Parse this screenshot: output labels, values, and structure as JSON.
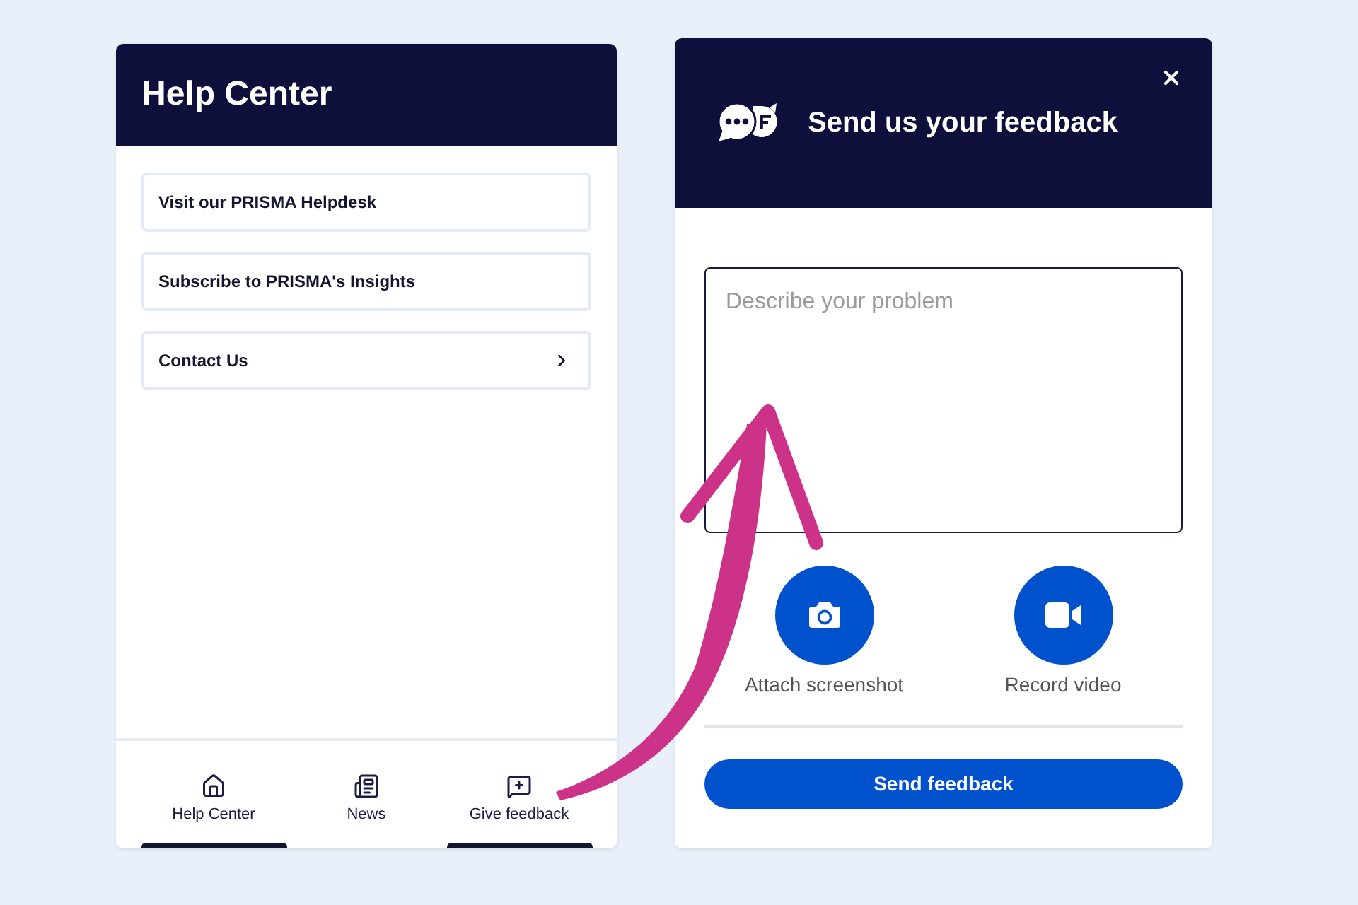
{
  "help_center": {
    "title": "Help Center",
    "links": [
      {
        "label": "Visit our PRISMA Helpdesk",
        "kind": "link"
      },
      {
        "label": "Subscribe to PRISMA's Insights",
        "kind": "link"
      },
      {
        "label": "Contact Us",
        "kind": "submenu"
      }
    ],
    "bottom_nav": [
      {
        "label": "Help Center",
        "kind": "home",
        "selected": true
      },
      {
        "label": "News",
        "kind": "news",
        "selected": false
      },
      {
        "label": "Give feedback",
        "kind": "feedback",
        "selected": true
      }
    ]
  },
  "feedback_panel": {
    "title": "Send us your feedback",
    "description_field": {
      "placeholder": "Describe your problem"
    },
    "attachments": [
      {
        "kind": "screenshot",
        "label": "Attach screenshot"
      },
      {
        "kind": "video",
        "label": "Record video"
      }
    ],
    "submit_button": "Send feedback"
  }
}
